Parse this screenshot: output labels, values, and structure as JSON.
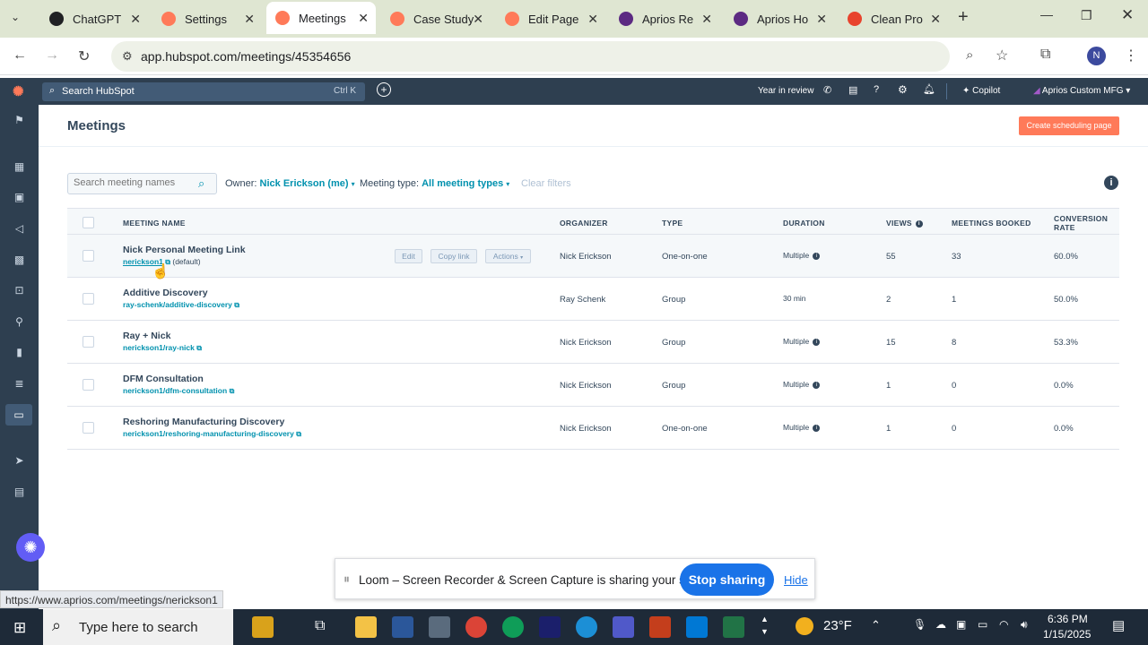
{
  "browser": {
    "tabs": [
      {
        "label": "ChatGPT",
        "color": "#202124"
      },
      {
        "label": "Settings",
        "color": "#ff7a59"
      },
      {
        "label": "Meetings",
        "color": "#ff7a59"
      },
      {
        "label": "Case Study",
        "color": "#ff7a59"
      },
      {
        "label": "Edit Page",
        "color": "#ff7a59"
      },
      {
        "label": "Aprios Re",
        "color": "#5c2a82"
      },
      {
        "label": "Aprios Ho",
        "color": "#5c2a82"
      },
      {
        "label": "Clean Pro",
        "color": "#e8432d"
      }
    ],
    "active_tab": 2,
    "url": "app.hubspot.com/meetings/45354656",
    "profile_initial": "N"
  },
  "hubspot_nav": {
    "search_placeholder": "Search HubSpot",
    "search_shortcut": "Ctrl K",
    "year_in_review": "Year in review",
    "copilot": "Copilot",
    "account": "Aprios Custom MFG"
  },
  "page": {
    "title": "Meetings",
    "create_button": "Create scheduling page"
  },
  "filters": {
    "search_placeholder": "Search meeting names",
    "owner_label": "Owner:",
    "owner_value": "Nick Erickson (me)",
    "type_label": "Meeting type:",
    "type_value": "All meeting types",
    "clear": "Clear filters"
  },
  "table": {
    "headers": {
      "name": "MEETING NAME",
      "organizer": "ORGANIZER",
      "type": "TYPE",
      "duration": "DURATION",
      "views": "VIEWS",
      "booked": "MEETINGS BOOKED",
      "conversion_1": "CONVERSION",
      "conversion_2": "RATE"
    },
    "row_actions": {
      "edit": "Edit",
      "copy": "Copy link",
      "actions": "Actions"
    },
    "rows": [
      {
        "name": "Nick Personal Meeting Link",
        "link": "nerickson1",
        "default": "(default)",
        "organizer": "Nick Erickson",
        "type": "One-on-one",
        "duration": "Multiple",
        "views": "55",
        "booked": "33",
        "rate": "60.0%"
      },
      {
        "name": "Additive Discovery",
        "link": "ray-schenk/additive-discovery",
        "default": "",
        "organizer": "Ray Schenk",
        "type": "Group",
        "duration": "30 min",
        "views": "2",
        "booked": "1",
        "rate": "50.0%"
      },
      {
        "name": "Ray + Nick",
        "link": "nerickson1/ray-nick",
        "default": "",
        "organizer": "Nick Erickson",
        "type": "Group",
        "duration": "Multiple",
        "views": "15",
        "booked": "8",
        "rate": "53.3%"
      },
      {
        "name": "DFM Consultation",
        "link": "nerickson1/dfm-consultation",
        "default": "",
        "organizer": "Nick Erickson",
        "type": "Group",
        "duration": "Multiple",
        "views": "1",
        "booked": "0",
        "rate": "0.0%"
      },
      {
        "name": "Reshoring Manufacturing Discovery",
        "link": "nerickson1/reshoring-manufacturing-discovery",
        "default": "",
        "organizer": "Nick Erickson",
        "type": "One-on-one",
        "duration": "Multiple",
        "views": "1",
        "booked": "0",
        "rate": "0.0%"
      }
    ]
  },
  "loom": {
    "message": "Loom – Screen Recorder & Screen Capture is sharing your screen.",
    "stop": "Stop sharing",
    "hide": "Hide"
  },
  "status_url": "https://www.aprios.com/meetings/nerickson1",
  "taskbar": {
    "search_placeholder": "Type here to search",
    "temperature": "23°F",
    "time": "6:36 PM",
    "date": "1/15/2025"
  }
}
